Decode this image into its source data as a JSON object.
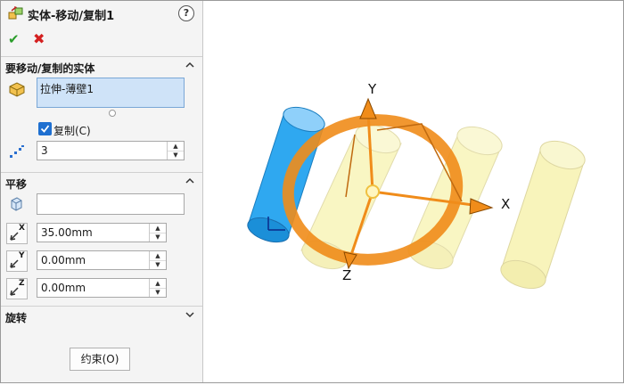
{
  "panel": {
    "title": "实体-移动/复制1",
    "help_label": "?",
    "ok_symbol": "✔",
    "cancel_symbol": "✖"
  },
  "bodies_section": {
    "header": "要移动/复制的实体",
    "selected_body": "拉伸-薄壁1",
    "copy_label": "复制(C)",
    "copy_checked": true,
    "copies_count": "3"
  },
  "translate_section": {
    "header": "平移",
    "reference_value": "",
    "dx_label": "X",
    "dx_value": "35.00mm",
    "dy_label": "Y",
    "dy_value": "0.00mm",
    "dz_label": "Z",
    "dz_value": "0.00mm"
  },
  "rotate_section": {
    "header": "旋转"
  },
  "constraints_button": "约束(O)",
  "viewport": {
    "axis_x": "X",
    "axis_y": "Y",
    "axis_z": "Z",
    "colors": {
      "selected_body": "#2fa8f0",
      "preview_body": "#f7f3b0",
      "triad": "#f08c1a"
    }
  }
}
